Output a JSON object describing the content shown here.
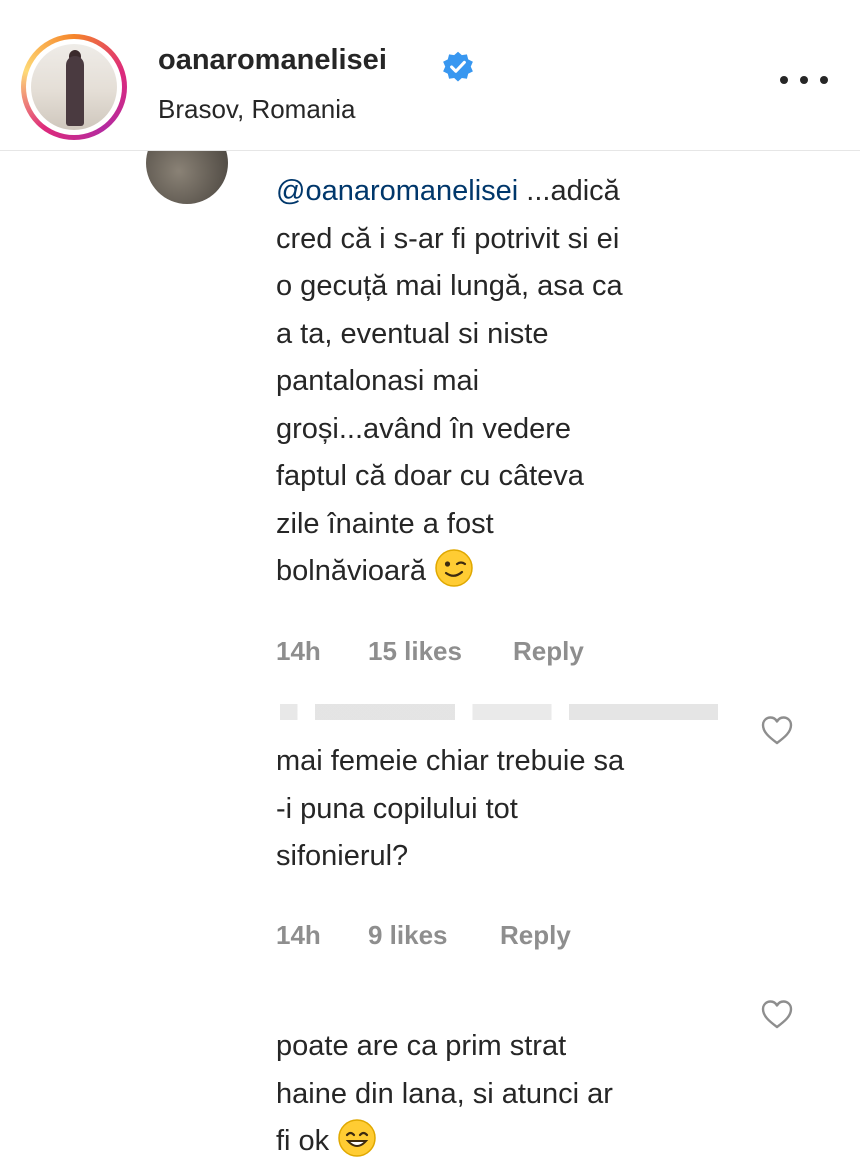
{
  "header": {
    "username": "oanaromanelisei",
    "location": "Brasov, Romania"
  },
  "comments": [
    {
      "mention": "@oanaromanelisei",
      "text": " ...adică\ncred că i s-ar fi potrivit si ei\no gecuță mai lungă, asa ca\na ta, eventual si niste\npantalonasi mai\ngroși...având în vedere\nfaptul că doar cu câteva\nzile înainte a fost\nbolnăvioară",
      "emoji": "winking-face",
      "time": "14h",
      "likes": "15 likes",
      "reply_label": "Reply"
    },
    {
      "text": "mai femeie chiar trebuie sa\n-i puna copilului tot\nsifonierul?",
      "time": "14h",
      "likes": "9 likes",
      "reply_label": "Reply"
    },
    {
      "text": "poate are ca prim strat\nhaine din lana, si atunci ar\nfi ok",
      "emoji": "smiling-face"
    }
  ],
  "colors": {
    "text": "#262626",
    "meta": "#8e8e8e",
    "mention": "#00376b",
    "verified": "#3897f0"
  }
}
